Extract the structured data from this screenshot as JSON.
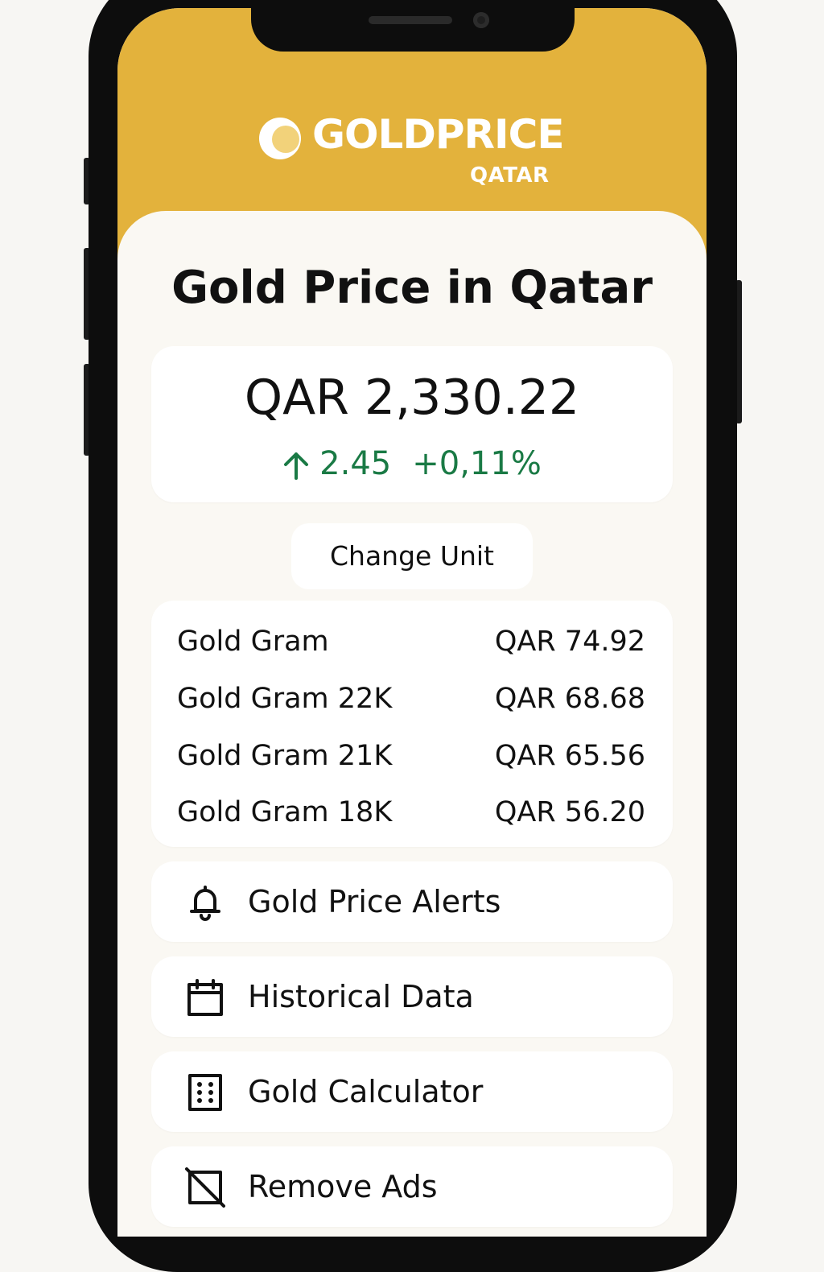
{
  "header": {
    "brand": "GOLDPRICE",
    "region": "QATAR",
    "colors": {
      "header_bg": "#e3b23c",
      "content_bg": "#faf8f3",
      "positive": "#1a7a45"
    }
  },
  "main": {
    "title": "Gold Price in Qatar",
    "price": {
      "currency": "QAR",
      "value": "2,330.22",
      "change": "2.45",
      "change_percent": "+0,11%",
      "trend_icon": "arrow-up-icon"
    },
    "change_unit_label": "Change Unit",
    "rates": [
      {
        "label": "Gold Gram",
        "value": "QAR 74.92"
      },
      {
        "label": "Gold Gram 22K",
        "value": "QAR 68.68"
      },
      {
        "label": "Gold Gram 21K",
        "value": "QAR 65.56"
      },
      {
        "label": "Gold Gram 18K",
        "value": "QAR 56.20"
      }
    ],
    "menu": [
      {
        "label": "Gold Price Alerts",
        "icon": "bell-icon"
      },
      {
        "label": "Historical Data",
        "icon": "calendar-icon"
      },
      {
        "label": "Gold Calculator",
        "icon": "calculator-icon"
      },
      {
        "label": "Remove Ads",
        "icon": "no-ads-icon"
      }
    ]
  }
}
